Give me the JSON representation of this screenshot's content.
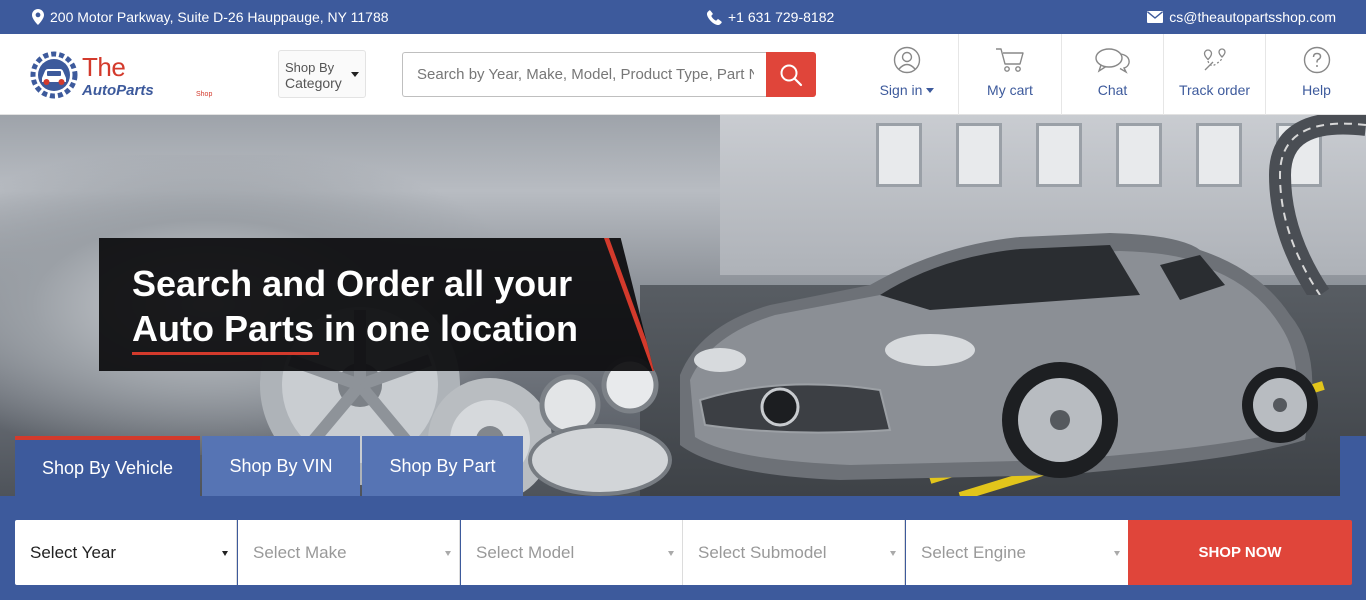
{
  "topbar": {
    "address": "200 Motor Parkway, Suite D-26 Hauppauge, NY 11788",
    "phone": "+1 631 729-8182",
    "email": "cs@theautopartsshop.com"
  },
  "logo": {
    "line1": "The",
    "line2": "AutoParts",
    "line3": "Shop"
  },
  "category_dropdown": {
    "line1": "Shop By",
    "line2": "Category"
  },
  "search": {
    "placeholder": "Search by Year, Make, Model, Product Type, Part Number",
    "value": ""
  },
  "nav": {
    "signin": "Sign in",
    "cart": "My cart",
    "chat": "Chat",
    "track": "Track order",
    "help": "Help"
  },
  "hero": {
    "headline_line1": "Search and Order all your",
    "headline_line2": "Auto Parts in one location"
  },
  "tabs": {
    "vehicle": "Shop By Vehicle",
    "vin": "Shop By VIN",
    "part": "Shop By Part"
  },
  "finder": {
    "year": "Select Year",
    "make": "Select Make",
    "model": "Select Model",
    "submodel": "Select Submodel",
    "engine": "Select Engine",
    "submit": "SHOP NOW"
  },
  "colors": {
    "brand_blue": "#3d5a9c",
    "brand_red": "#e0453a"
  }
}
